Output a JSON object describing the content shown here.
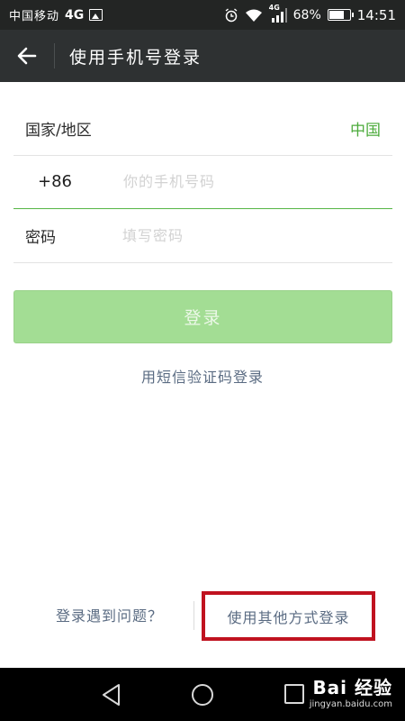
{
  "status_bar": {
    "carrier": "中国移动",
    "network": "4G",
    "signal_network": "4G",
    "battery_percent": "68%",
    "time": "14:51",
    "icons": [
      "gallery-icon",
      "alarm-icon",
      "wifi-icon",
      "signal-icon",
      "battery-icon"
    ]
  },
  "title_bar": {
    "back_icon": "arrow-left-icon",
    "title": "使用手机号登录"
  },
  "form": {
    "region_label": "国家/地区",
    "region_value": "中国",
    "country_code": "+86",
    "phone_placeholder": "你的手机号码",
    "phone_value": "",
    "password_label": "密码",
    "password_placeholder": "填写密码",
    "password_value": ""
  },
  "actions": {
    "login_label": "登录",
    "sms_login_label": "用短信验证码登录"
  },
  "bottom": {
    "problem_label": "登录遇到问题？",
    "other_method_label": "使用其他方式登录"
  },
  "nav_bar": {
    "icons": [
      "back-triangle-icon",
      "home-circle-icon",
      "recent-square-icon"
    ]
  },
  "watermark": {
    "brand": "Bai 经验",
    "url": "jingyan.baidu.com"
  },
  "colors": {
    "status_bar_bg": "#232524",
    "title_bar_bg": "#2e3132",
    "accent_green": "#4cab3b",
    "login_button_bg": "#a3dd94",
    "link_text": "#5a6b82",
    "highlight_border": "#c0121f"
  }
}
